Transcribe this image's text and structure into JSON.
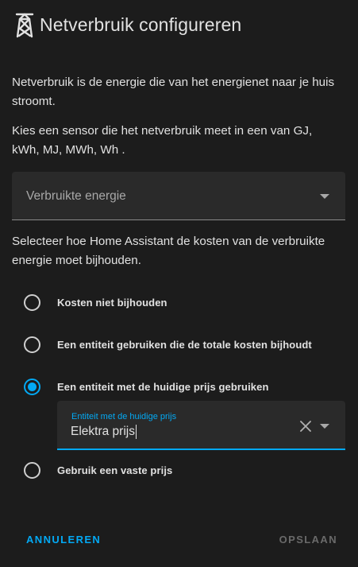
{
  "dialog": {
    "title": "Netverbruik configureren",
    "icon": "transmission-tower-icon"
  },
  "intro": "Netverbruik is de energie die van het energienet naar je huis stroomt.",
  "sensor_hint": "Kies een sensor die het netverbruik meet in een van GJ, kWh, MJ, MWh, Wh .",
  "sensor_select": {
    "label": "Verbruikte energie"
  },
  "cost_hint": "Selecteer hoe Home Assistant de kosten van de verbruikte energie moet bijhouden.",
  "cost_options": [
    {
      "label": "Kosten niet bijhouden",
      "checked": false
    },
    {
      "label": "Een entiteit gebruiken die de totale kosten bijhoudt",
      "checked": false
    },
    {
      "label": "Een entiteit met de huidige prijs gebruiken",
      "checked": true
    },
    {
      "label": "Gebruik een vaste prijs",
      "checked": false
    }
  ],
  "entity_field": {
    "label": "Entiteit met de huidige prijs",
    "value": "Elektra prijs"
  },
  "actions": {
    "cancel": "ANNULEREN",
    "save": "OPSLAAN"
  },
  "colors": {
    "accent": "#03a9f4",
    "background": "#1c1c1c",
    "field": "#2a2a2a",
    "disabled": "#6a6a6a"
  }
}
